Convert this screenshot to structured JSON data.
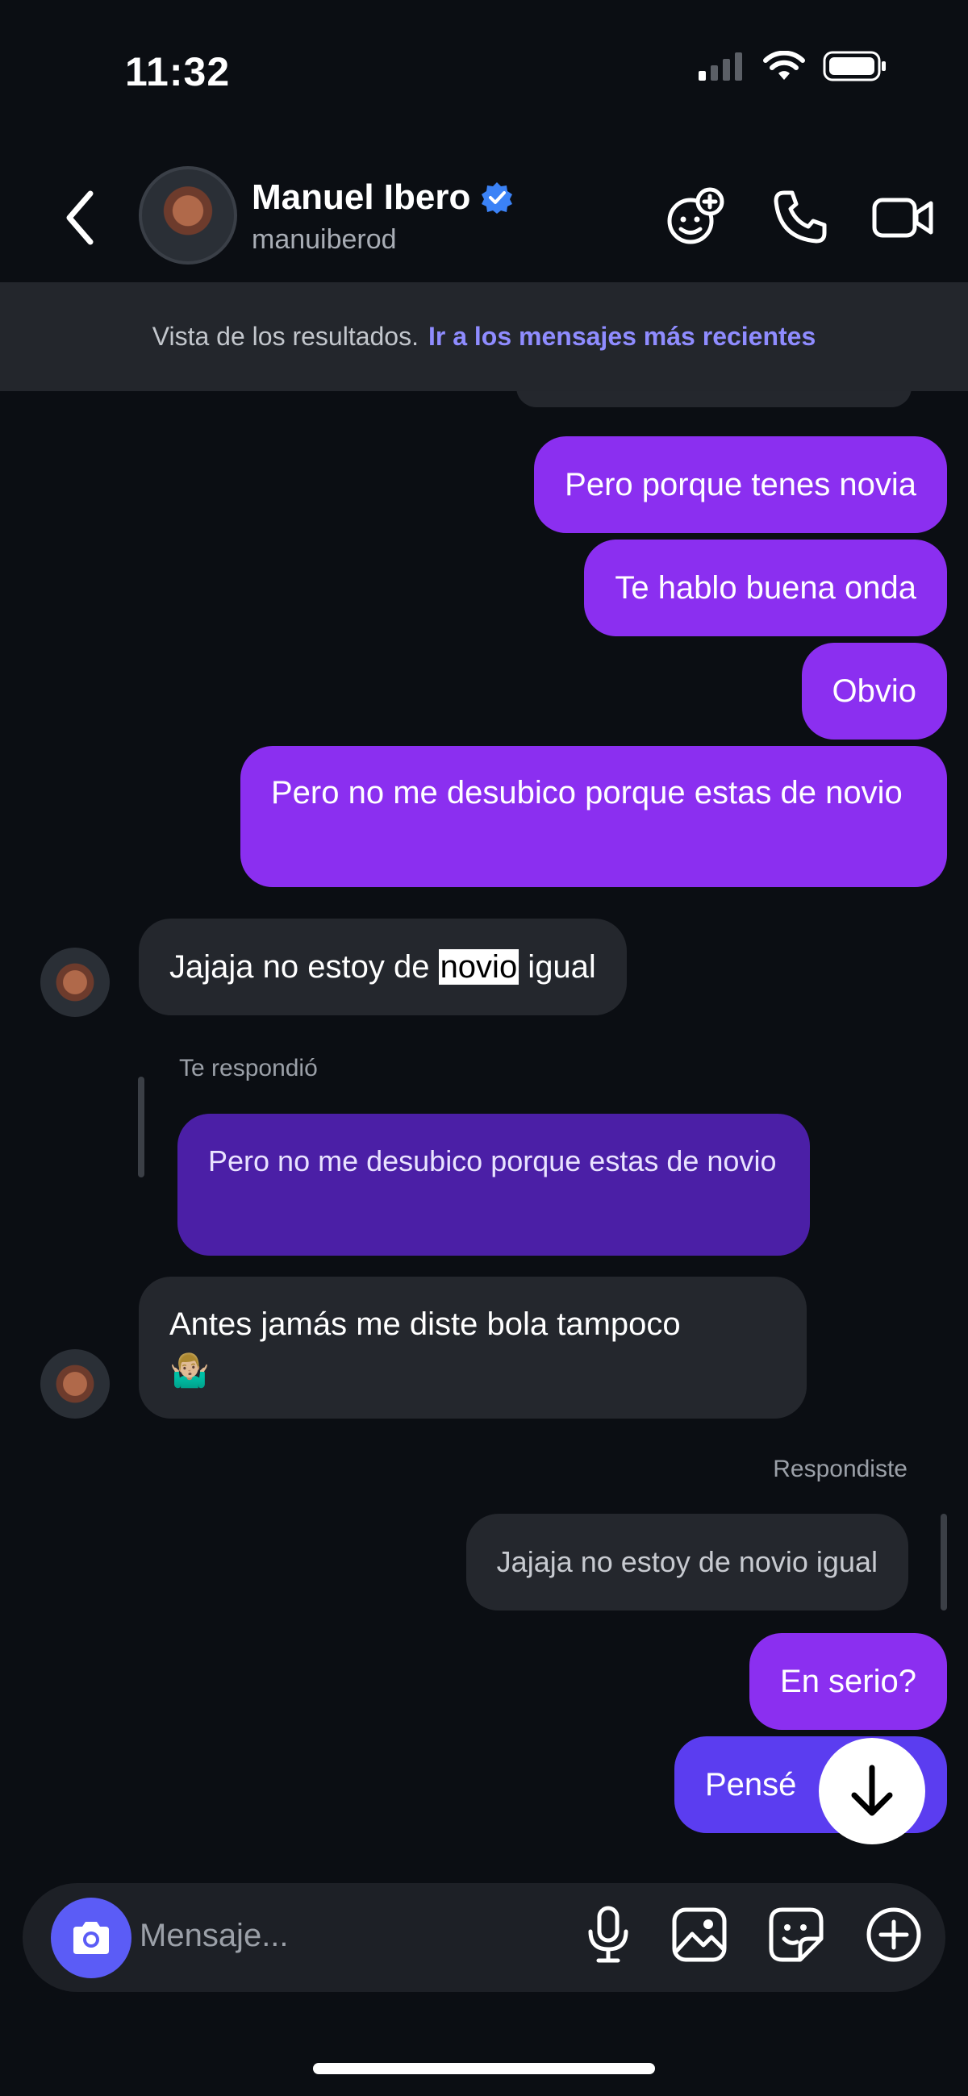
{
  "status_bar": {
    "time": "11:32"
  },
  "header": {
    "name": "Manuel Ibero",
    "username": "manuiberod",
    "accent": "#3b82f6"
  },
  "banner": {
    "text": "Vista de los resultados.",
    "link": "Ir a los mensajes más recientes",
    "link_color": "#8f8cff"
  },
  "messages": {
    "m1": "Pero porque tenes novia",
    "m2": "Te hablo buena onda",
    "m3": "Obvio",
    "m4": "Pero no me desubico porque estas de novio",
    "m5_pre": "Jajaja no estoy de ",
    "m5_hl": "novio",
    "m5_post": " igual",
    "reply_label_in": "Te respondió",
    "quoted_out": "Pero no me desubico porque estas de novio",
    "m6": "Antes jamás me diste bola tampoco",
    "m6_emoji": "🤷🏼‍♂️",
    "reply_label_out": "Respondiste",
    "quoted_in": "Jajaja no estoy de novio igual",
    "m7": "En serio?",
    "m8": "Pensé"
  },
  "composer": {
    "placeholder": "Mensaje..."
  },
  "colors": {
    "outgoing": "#8b2ff0",
    "incoming": "#24272d",
    "quoted_outgoing": "#4b1fa6",
    "camera": "#5b5cf6"
  }
}
